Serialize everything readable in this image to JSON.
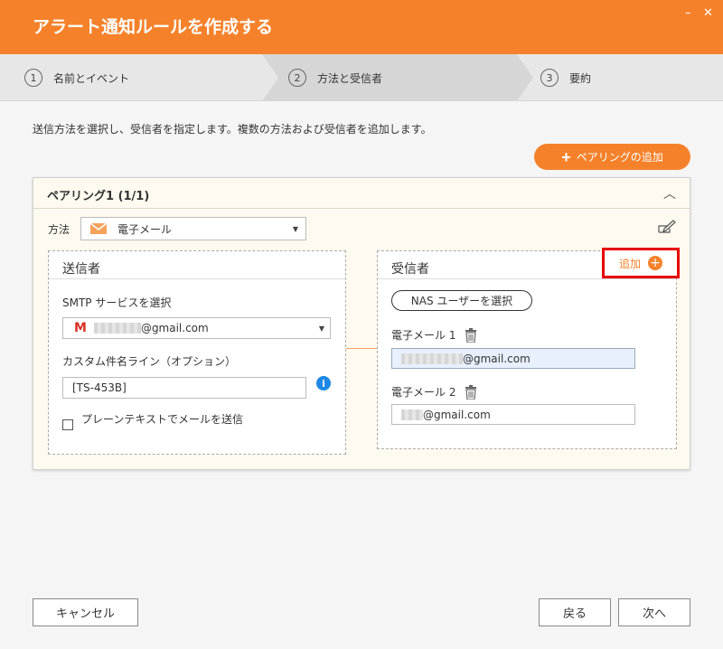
{
  "window": {
    "title": "アラート通知ルールを作成する",
    "minimize": "–",
    "close": "✕"
  },
  "steps": [
    {
      "num": "1",
      "label": "名前とイベント"
    },
    {
      "num": "2",
      "label": "方法と受信者"
    },
    {
      "num": "3",
      "label": "要約"
    }
  ],
  "description": "送信方法を選択し、受信者を指定します。複数の方法および受信者を追加します。",
  "add_pairing_label": "ペアリングの追加",
  "pairing": {
    "title": "ペアリング1 (1/1)",
    "method_label": "方法",
    "method_value": "電子メール",
    "sender": {
      "title": "送信者",
      "smtp_label": "SMTP サービスを選択",
      "smtp_value": "@gmail.com",
      "subject_label": "カスタム件名ライン（オプション）",
      "subject_value": "[TS-453B]",
      "plain_text_label": "プレーンテキストでメールを送信"
    },
    "recipient": {
      "title": "受信者",
      "add_label": "追加",
      "nas_button": "NAS ユーザーを選択",
      "emails": [
        {
          "label": "電子メール 1",
          "value": "@gmail.com"
        },
        {
          "label": "電子メール 2",
          "value": "@gmail.com"
        }
      ]
    }
  },
  "footer": {
    "cancel": "キャンセル",
    "back": "戻る",
    "next": "次へ"
  },
  "colors": {
    "accent": "#f5822b",
    "highlight": "#e60000",
    "info": "#1e88e5"
  }
}
